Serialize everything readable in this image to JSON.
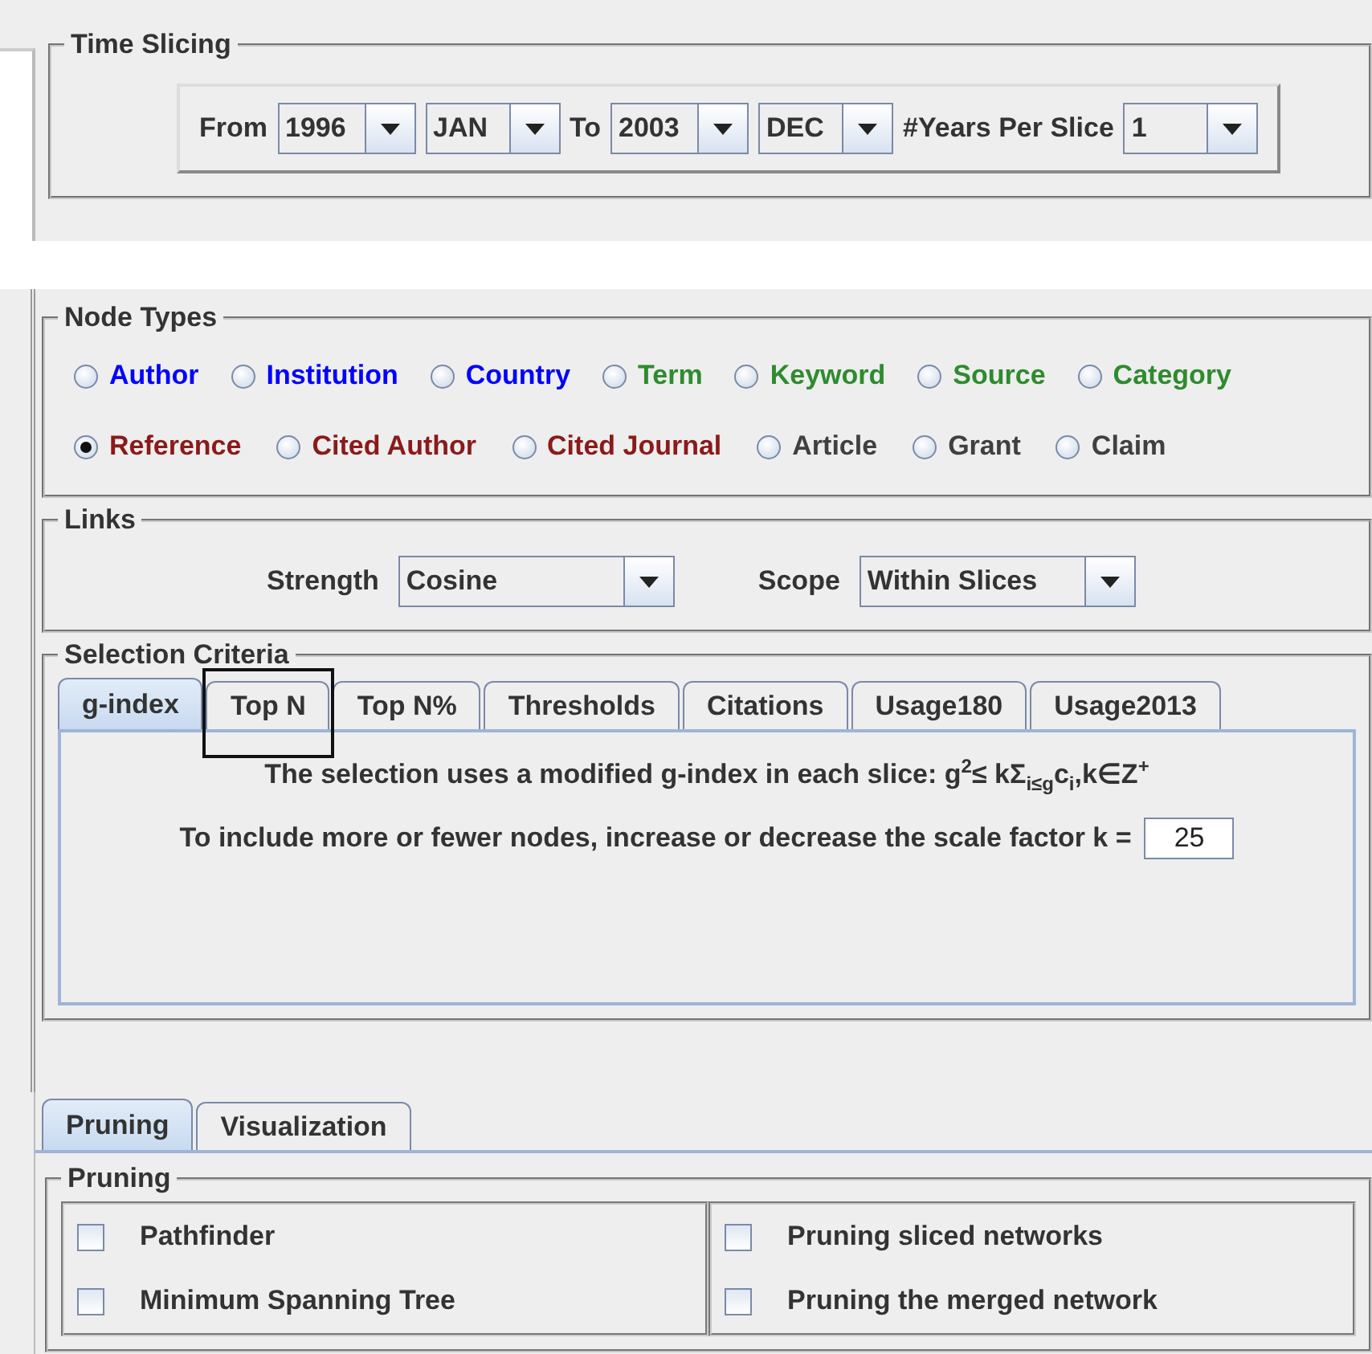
{
  "time_slicing": {
    "title": "Time Slicing",
    "from_label": "From",
    "from_year": "1996",
    "from_month": "JAN",
    "to_label": "To",
    "to_year": "2003",
    "to_month": "DEC",
    "years_label": "#Years Per Slice",
    "years_per_slice": "1"
  },
  "node_types": {
    "title": "Node Types",
    "rows": [
      {
        "items": [
          {
            "label": "Author",
            "color": "#0000ff",
            "selected": false
          },
          {
            "label": "Institution",
            "color": "#0000ff",
            "selected": false
          },
          {
            "label": "Country",
            "color": "#0000ff",
            "selected": false
          },
          {
            "label": "Term",
            "color": "#2e8b2e",
            "selected": false
          },
          {
            "label": "Keyword",
            "color": "#2e8b2e",
            "selected": false
          },
          {
            "label": "Source",
            "color": "#2e8b2e",
            "selected": false
          },
          {
            "label": "Category",
            "color": "#2e8b2e",
            "selected": false
          }
        ]
      },
      {
        "items": [
          {
            "label": "Reference",
            "color": "#8b1a1a",
            "selected": true
          },
          {
            "label": "Cited Author",
            "color": "#8b1a1a",
            "selected": false
          },
          {
            "label": "Cited Journal",
            "color": "#8b1a1a",
            "selected": false
          },
          {
            "label": "Article",
            "color": "#404040",
            "selected": false
          },
          {
            "label": "Grant",
            "color": "#404040",
            "selected": false
          },
          {
            "label": "Claim",
            "color": "#404040",
            "selected": false
          }
        ]
      }
    ]
  },
  "links": {
    "title": "Links",
    "strength_label": "Strength",
    "strength": "Cosine",
    "scope_label": "Scope",
    "scope": "Within Slices"
  },
  "selection_criteria": {
    "title": "Selection Criteria",
    "tabs": [
      {
        "label": "g-index",
        "selected": true
      },
      {
        "label": "Top N",
        "selected": false
      },
      {
        "label": "Top N%",
        "selected": false
      },
      {
        "label": "Thresholds",
        "selected": false
      },
      {
        "label": "Citations",
        "selected": false
      },
      {
        "label": "Usage180",
        "selected": false
      },
      {
        "label": "Usage2013",
        "selected": false
      }
    ],
    "formula": "The selection uses a modified g-index in each slice: g$^{2}$≤ kΣ$_{i≤g}$c$_{i}$,k∈Z$^{+}$",
    "scale_label": "To include more or fewer nodes, increase or decrease the scale factor k =",
    "scale_value": "25"
  },
  "bottom_tabs": [
    {
      "label": "Pruning",
      "selected": true
    },
    {
      "label": "Visualization",
      "selected": false
    }
  ],
  "pruning": {
    "title": "Pruning",
    "columns": [
      {
        "options": [
          {
            "label": "Pathfinder",
            "checked": false
          },
          {
            "label": "Minimum Spanning Tree",
            "checked": false
          }
        ]
      },
      {
        "options": [
          {
            "label": "Pruning sliced networks",
            "checked": false
          },
          {
            "label": "Pruning the merged network",
            "checked": false
          }
        ]
      }
    ]
  }
}
